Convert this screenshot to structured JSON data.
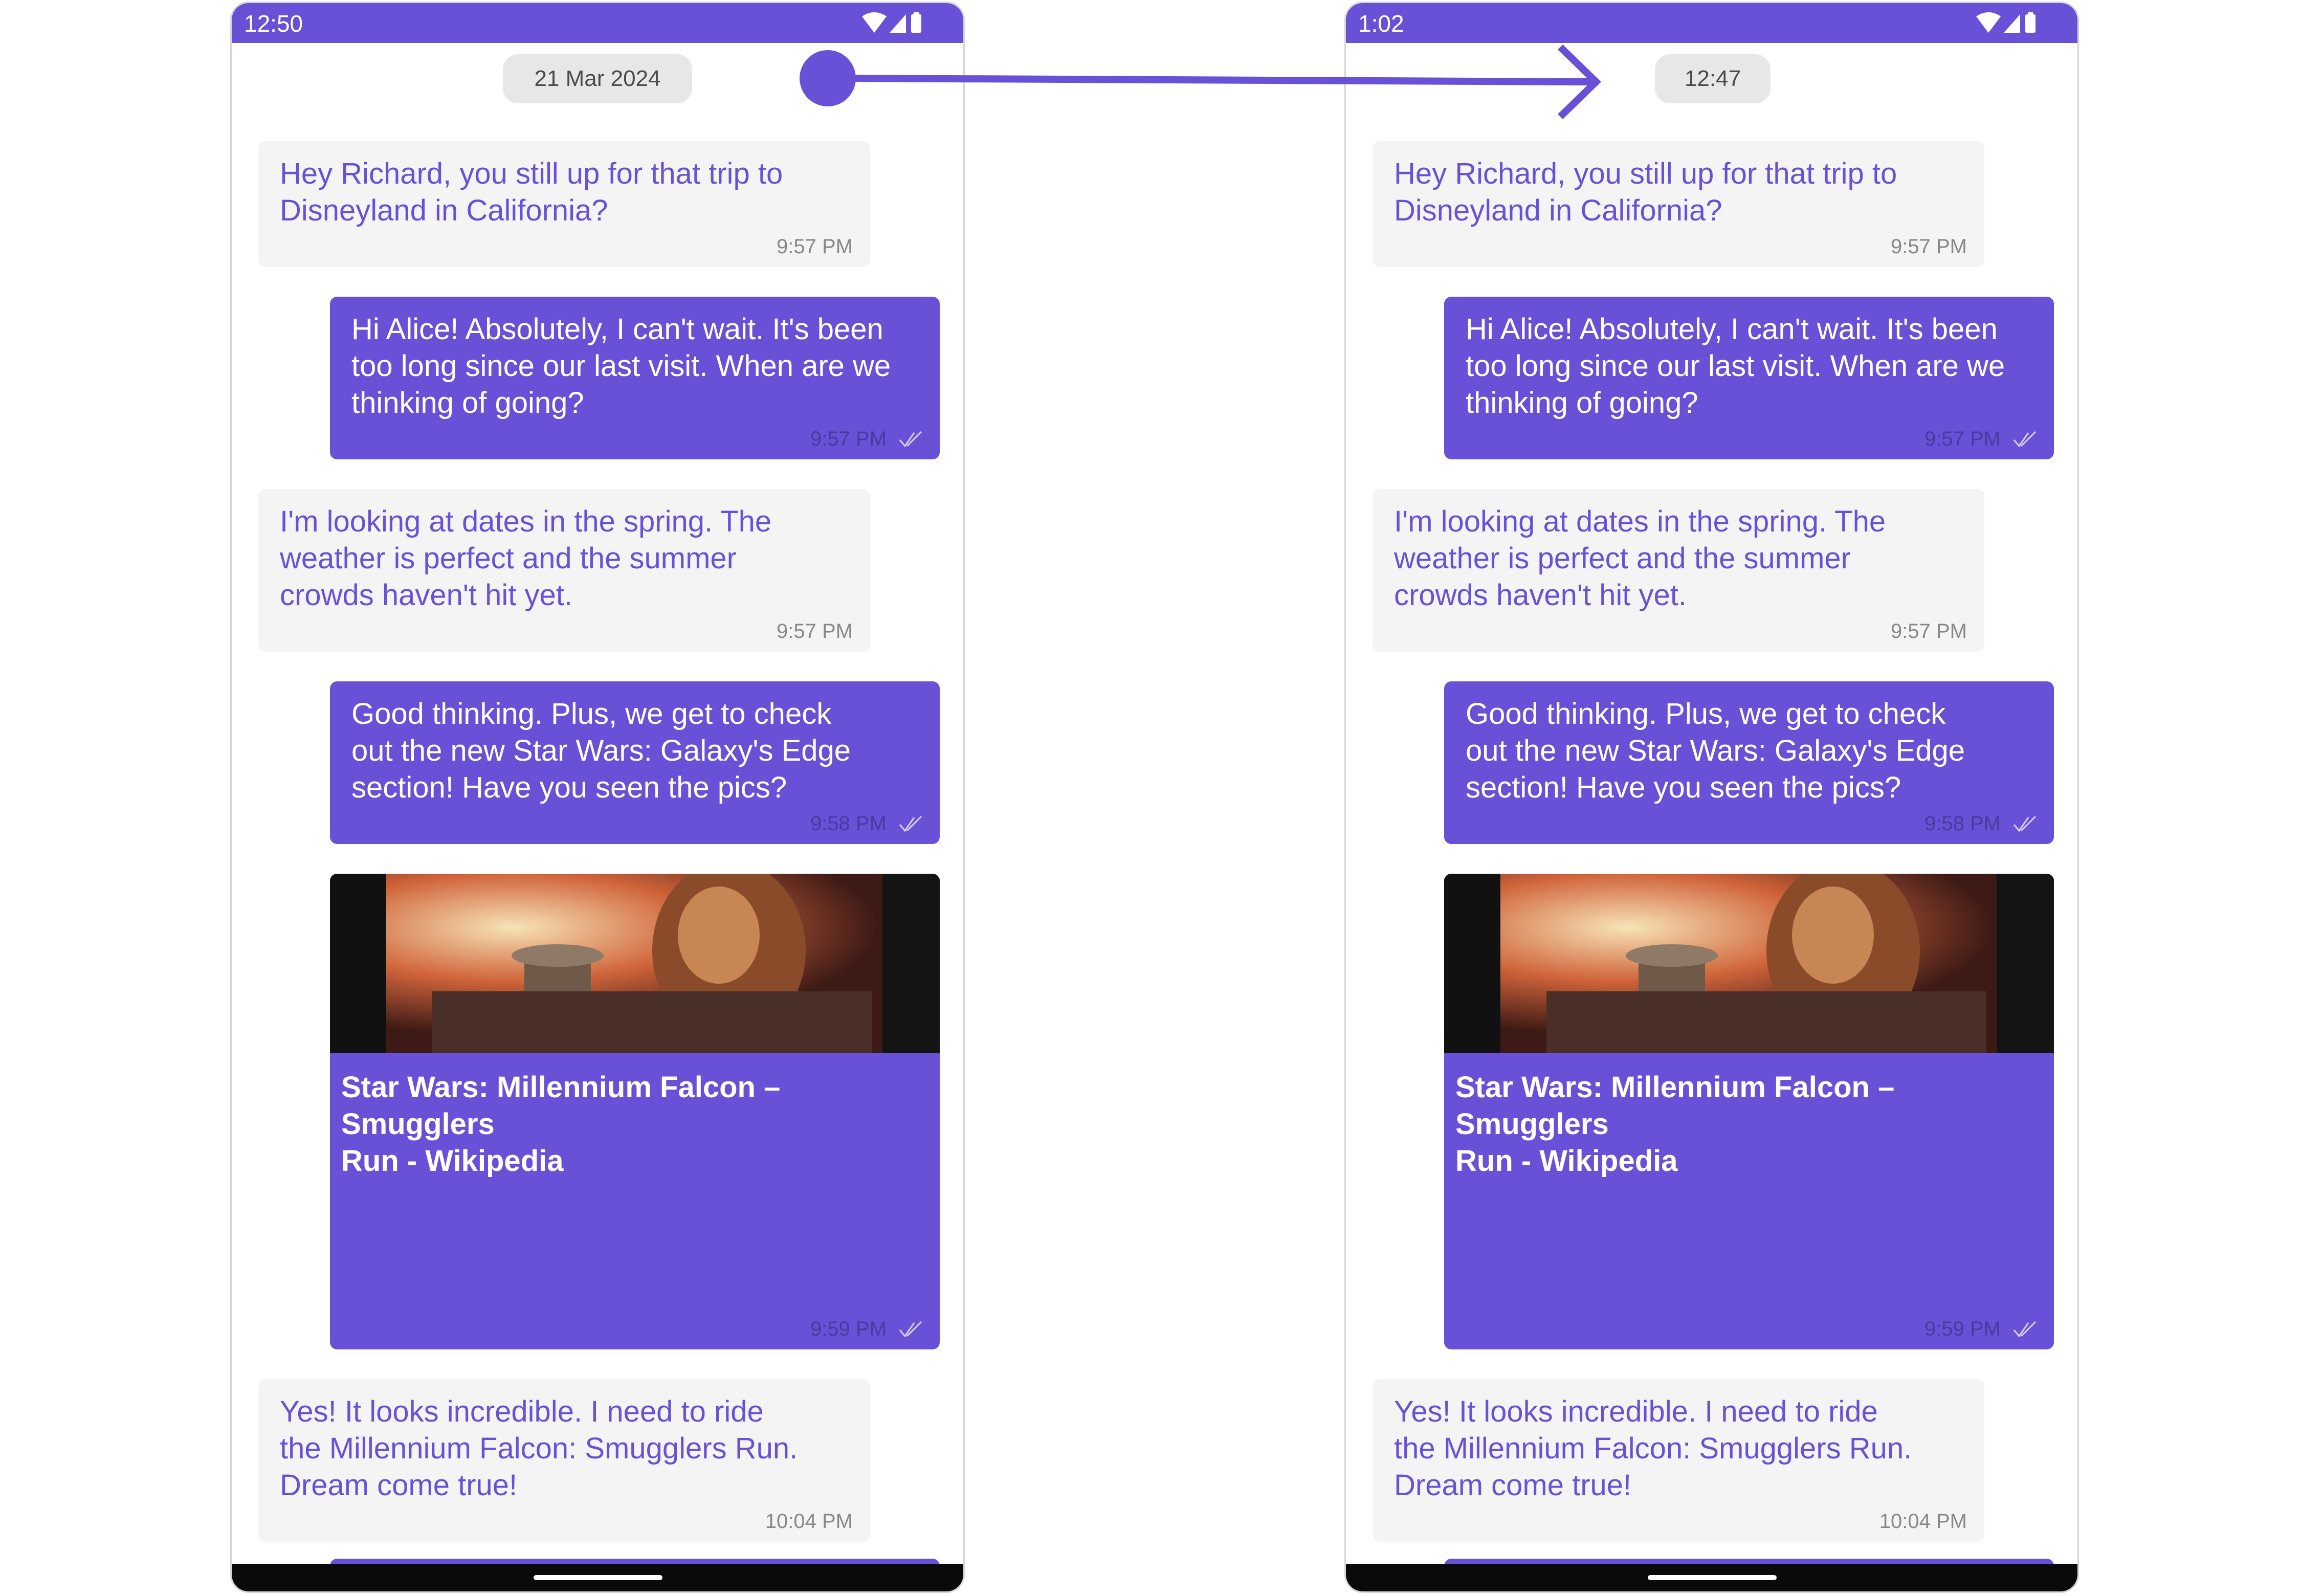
{
  "colors": {
    "accent": "#6851d6",
    "incoming_bubble": "#f4f4f4",
    "date_chip": "#e7e7e7"
  },
  "screens": [
    {
      "status_time": "12:50",
      "date_separator": "21 Mar 2024",
      "messages": [
        {
          "direction": "incoming",
          "text": "Hey Richard, you still up for that trip to\nDisneyland in California?",
          "time": "9:57 PM"
        },
        {
          "direction": "outgoing",
          "text": "Hi Alice! Absolutely, I can't wait. It's been\ntoo long since our last visit. When are we\nthinking of going?",
          "time": "9:57 PM",
          "receipt_icon": "check-icon"
        },
        {
          "direction": "incoming",
          "text": "I'm looking at dates in the spring. The\nweather is perfect and the summer\ncrowds haven't hit yet.",
          "time": "9:57 PM"
        },
        {
          "direction": "outgoing",
          "text": "Good thinking. Plus, we get to check\nout the new Star Wars: Galaxy's Edge\nsection! Have you seen the pics?",
          "time": "9:58 PM",
          "receipt_icon": "check-icon"
        },
        {
          "direction": "outgoing",
          "type": "link_preview",
          "title": "Star Wars: Millennium Falcon – Smugglers\nRun - Wikipedia",
          "time": "9:59 PM",
          "receipt_icon": "check-icon"
        },
        {
          "direction": "incoming",
          "text": "Yes! It looks incredible. I need to ride\nthe Millennium Falcon: Smugglers Run.\nDream come true!",
          "time": "10:04 PM"
        }
      ]
    },
    {
      "status_time": "1:02",
      "date_separator": "12:47",
      "messages": [
        {
          "direction": "incoming",
          "text": "Hey Richard, you still up for that trip to\nDisneyland in California?",
          "time": "9:57 PM"
        },
        {
          "direction": "outgoing",
          "text": "Hi Alice! Absolutely, I can't wait. It's been\ntoo long since our last visit. When are we\nthinking of going?",
          "time": "9:57 PM",
          "receipt_icon": "check-icon"
        },
        {
          "direction": "incoming",
          "text": "I'm looking at dates in the spring. The\nweather is perfect and the summer\ncrowds haven't hit yet.",
          "time": "9:57 PM"
        },
        {
          "direction": "outgoing",
          "text": "Good thinking. Plus, we get to check\nout the new Star Wars: Galaxy's Edge\nsection! Have you seen the pics?",
          "time": "9:58 PM",
          "receipt_icon": "check-icon"
        },
        {
          "direction": "outgoing",
          "type": "link_preview",
          "title": "Star Wars: Millennium Falcon – Smugglers\nRun - Wikipedia",
          "time": "9:59 PM",
          "receipt_icon": "check-icon"
        },
        {
          "direction": "incoming",
          "text": "Yes! It looks incredible. I need to ride\nthe Millennium Falcon: Smugglers Run.\nDream come true!",
          "time": "10:04 PM"
        }
      ]
    }
  ]
}
